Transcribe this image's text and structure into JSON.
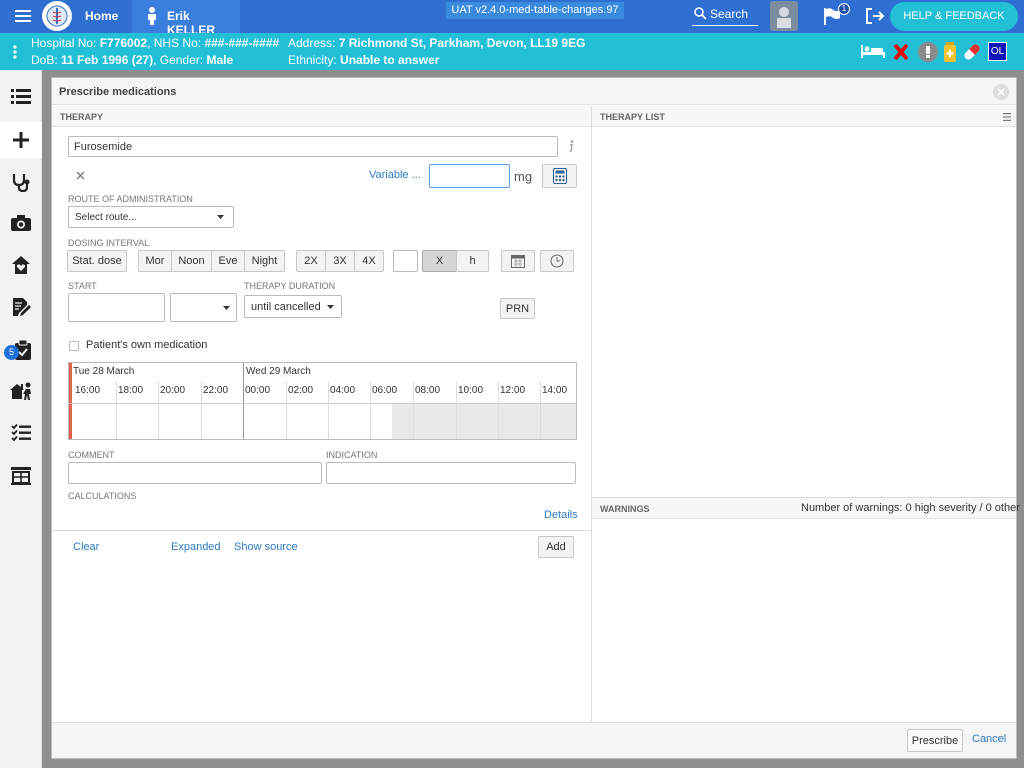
{
  "topbar": {
    "home_label": "Home",
    "user_name": "Erik KELLER",
    "env_label": "UAT v2.4.0-med-table-changes.97",
    "search_label": "Search",
    "flag_badge": "1",
    "help_label": "HELP & FEEDBACK"
  },
  "patient": {
    "hospital_label": "Hospital No: ",
    "hospital_no": "F776002",
    "nhs_label": ", NHS No: ",
    "nhs_no": "###-###-####",
    "dob_label": "DoB: ",
    "dob": "11 Feb 1996 (27)",
    "gender_label": ", Gender: ",
    "gender": "Male",
    "address_label": "Address: ",
    "address": "7 Richmond St, Parkham, Devon, LL19 9EG",
    "ethnicity_label": "Ethnicity: ",
    "ethnicity": "Unable to answer",
    "ol_badge": "OL"
  },
  "sidebar": {
    "badge": "5"
  },
  "dialog": {
    "title": "Prescribe medications",
    "therapy_header": "THERAPY",
    "therapy_list_header": "THERAPY LIST",
    "warnings_header": "WARNINGS",
    "warnings_count": "Number of warnings: 0 high severity / 0 other",
    "medication_value": "Furosemide",
    "variable_link": "Variable ...",
    "dose_value": "",
    "dose_unit": "mg",
    "route_label": "ROUTE OF ADMINISTRATION",
    "route_placeholder": "Select route...",
    "dosing_label": "DOSING INTERVAL",
    "stat_dose": "Stat. dose",
    "mor": "Mor",
    "noon": "Noon",
    "eve": "Eve",
    "night": "Night",
    "x2": "2X",
    "x3": "3X",
    "x4": "4X",
    "x_label": "X",
    "h_label": "h",
    "start_label": "START",
    "duration_label": "THERAPY DURATION",
    "duration_value": "until cancelled",
    "prn": "PRN",
    "own_med": "Patient's own medication",
    "timeline": {
      "day1": "Tue 28 March",
      "day2": "Wed 29 March",
      "hours": [
        "16:00",
        "18:00",
        "20:00",
        "22:00",
        "00:00",
        "02:00",
        "04:00",
        "06:00",
        "08:00",
        "10:00",
        "12:00",
        "14:00"
      ]
    },
    "comment_label": "COMMENT",
    "indication_label": "INDICATION",
    "calculations_label": "CALCULATIONS",
    "details_link": "Details",
    "clear_link": "Clear",
    "expanded_link": "Expanded",
    "show_source_link": "Show source",
    "add_button": "Add",
    "prescribe_button": "Prescribe",
    "cancel_link": "Cancel"
  },
  "colors": {
    "topbar": "#2e6fd1",
    "patient_bar": "#22bfd6",
    "link": "#2b7bbf",
    "now_marker": "#e0644e",
    "badge": "#1f6fd8"
  }
}
